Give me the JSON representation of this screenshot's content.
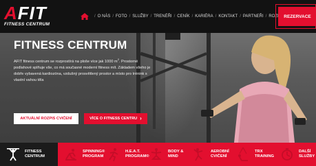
{
  "logo": {
    "main_letter": "A",
    "main_rest": "FIT",
    "tagline": "FITNESS CENTRUM"
  },
  "nav": {
    "items": [
      "O NÁS",
      "FOTO",
      "SLUŽBY",
      "TRENÉŘI",
      "CENÍK",
      "KARIÉRA",
      "KONTAKT",
      "PARTNEŘI",
      "ROZPIS LEKCÍ"
    ],
    "separator": "/",
    "reserve_label": "REZERVACE"
  },
  "hero": {
    "title": "FITNESS CENTRUM",
    "text_before_sup": "AFIT fitness centrum se rozprostírá na ploše více jak 1000 m",
    "text_sup": "2",
    "text_after_sup": ". Prostorné podlahové splňuje vše, co má současné moderní fitness mít. Základem všeho je dobře vybavená kardiozóna, vzdušný prosvětlený prostor a místo pro trénink s vlastní vahou těla",
    "btn_schedule": "AKTUÁLNÍ ROZPIS CVIČENÍ",
    "btn_more": "VÍCE O FITNESS CENTRU",
    "btn_more_chevron": "›"
  },
  "tabs": [
    {
      "label": "FITNESS\nCENTRUM",
      "icon": "weightlifter-icon",
      "active": true
    },
    {
      "label": "SPINNING®\nPROGRAM",
      "icon": "cyclist-icon",
      "active": false
    },
    {
      "label": "H.E.A.T.\nPROGRAM®",
      "icon": "runner-icon",
      "active": false
    },
    {
      "label": "BODY &\nMIND",
      "icon": "yoga-icon",
      "active": false
    },
    {
      "label": "AEROBNÍ\nCVIČENÍ",
      "icon": "aerobics-icon",
      "active": false
    },
    {
      "label": "TRX\nTRAINING",
      "icon": "trx-icon",
      "active": false
    },
    {
      "label": "DALŠÍ\nSLUŽBY",
      "icon": "services-icon",
      "active": false
    }
  ],
  "colors": {
    "accent": "#e30f2f",
    "dark": "#121212",
    "tab_active": "#1b1b1b"
  }
}
